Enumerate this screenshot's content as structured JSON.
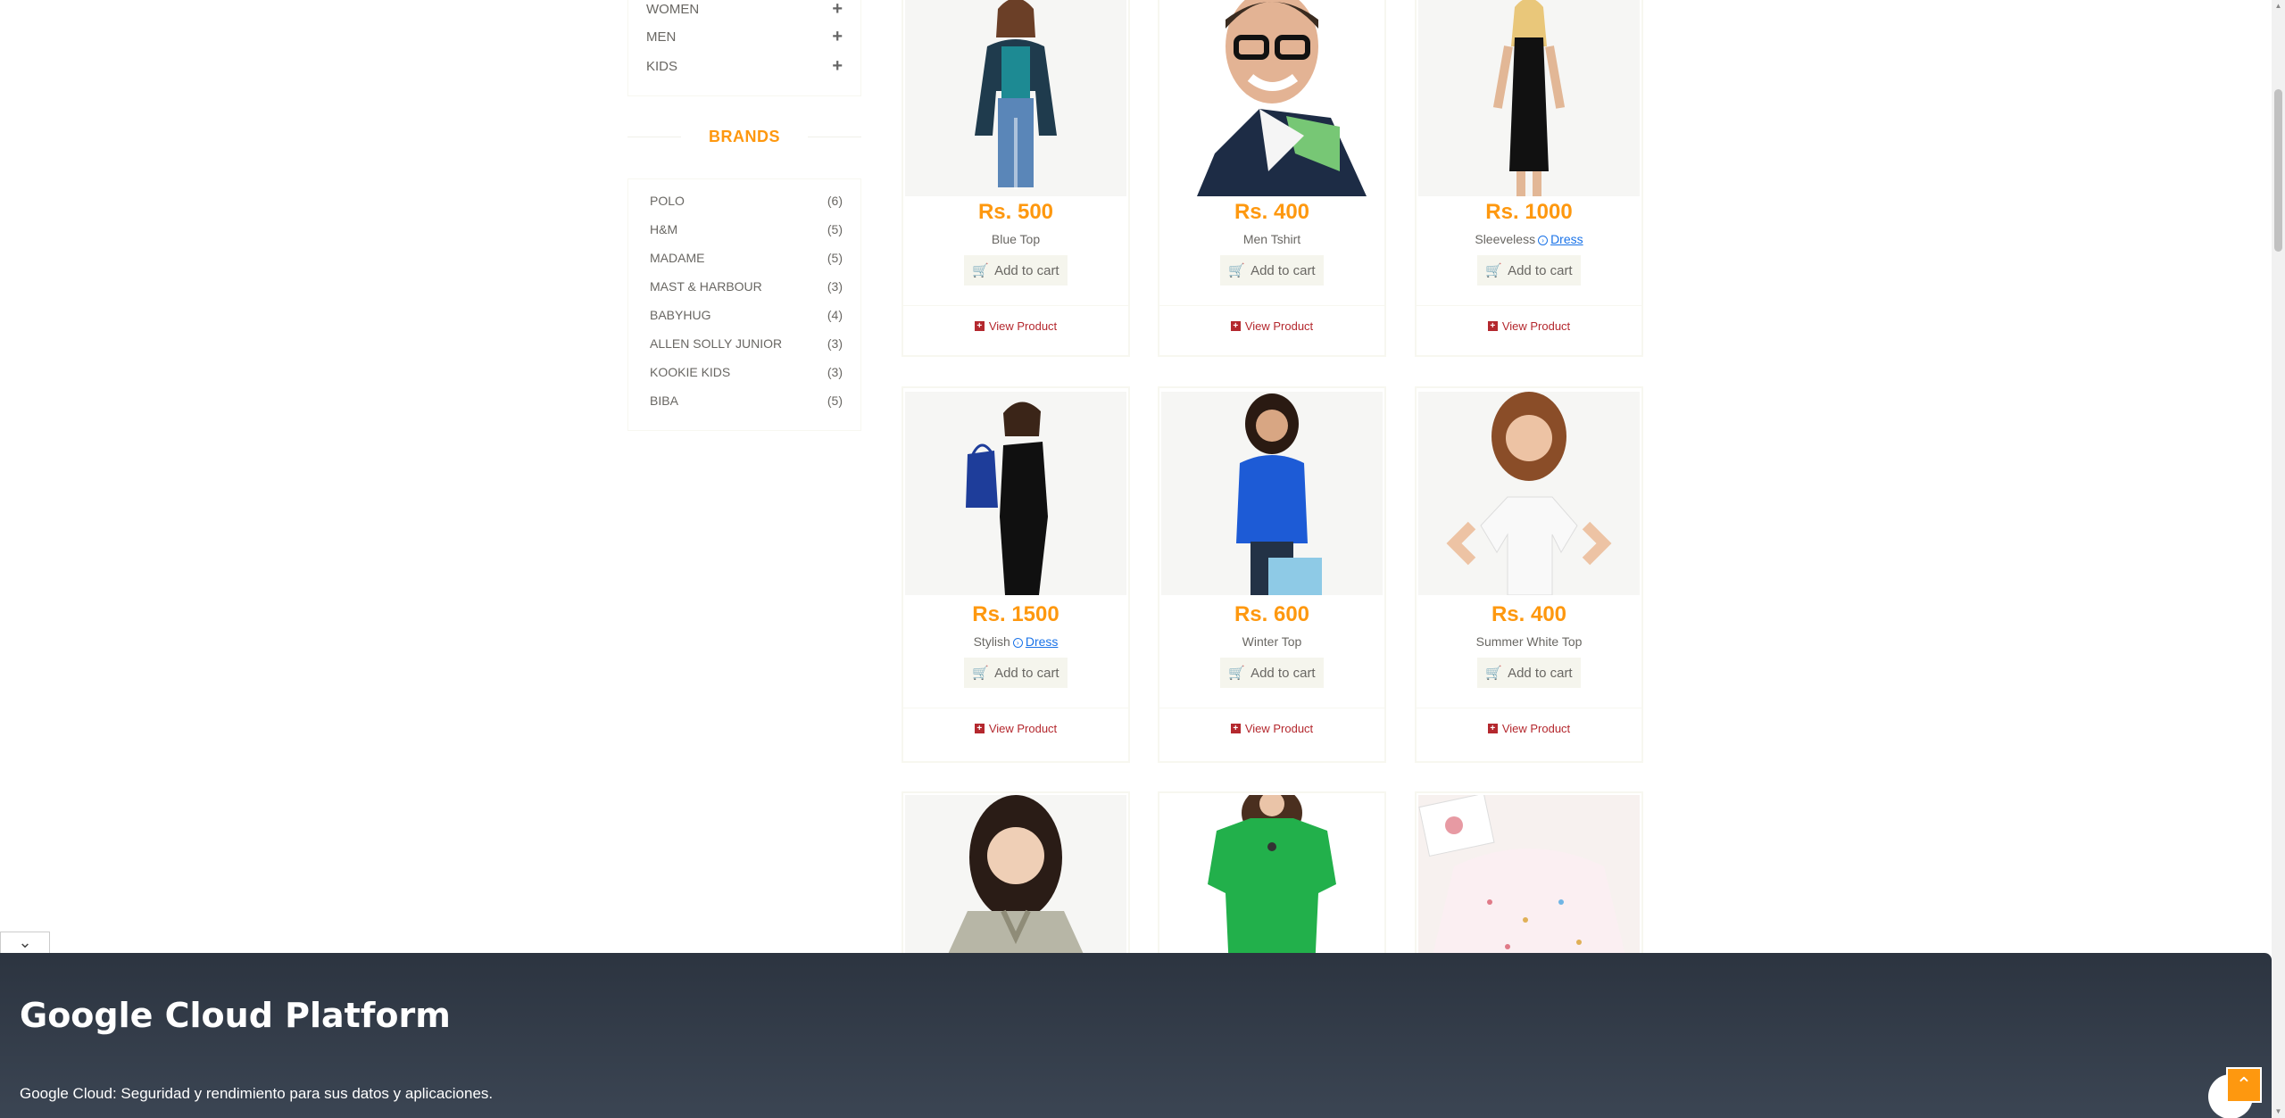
{
  "categories": [
    {
      "label": "WOMEN"
    },
    {
      "label": "MEN"
    },
    {
      "label": "KIDS"
    }
  ],
  "brands": {
    "title": "BRANDS",
    "items": [
      {
        "name": "POLO",
        "count": "(6)"
      },
      {
        "name": "H&M",
        "count": "(5)"
      },
      {
        "name": "MADAME",
        "count": "(5)"
      },
      {
        "name": "MAST & HARBOUR",
        "count": "(3)"
      },
      {
        "name": "BABYHUG",
        "count": "(4)"
      },
      {
        "name": "ALLEN SOLLY JUNIOR",
        "count": "(3)"
      },
      {
        "name": "KOOKIE KIDS",
        "count": "(3)"
      },
      {
        "name": "BIBA",
        "count": "(5)"
      }
    ]
  },
  "products": [
    {
      "price": "Rs. 500",
      "name": "Blue Top",
      "link": "",
      "cart": "Add to cart",
      "view": "View Product"
    },
    {
      "price": "Rs. 400",
      "name": "Men Tshirt",
      "link": "",
      "cart": "Add to cart",
      "view": "View Product"
    },
    {
      "price": "Rs. 1000",
      "name": "Sleeveless",
      "link": "Dress",
      "cart": "Add to cart",
      "view": "View Product"
    },
    {
      "price": "Rs. 1500",
      "name": "Stylish",
      "link": "Dress",
      "cart": "Add to cart",
      "view": "View Product"
    },
    {
      "price": "Rs. 600",
      "name": "Winter Top",
      "link": "",
      "cart": "Add to cart",
      "view": "View Product"
    },
    {
      "price": "Rs. 400",
      "name": "Summer White Top",
      "link": "",
      "cart": "Add to cart",
      "view": "View Product"
    }
  ],
  "ad": {
    "title": "Google Cloud Platform",
    "subtitle": "Google Cloud: Seguridad y rendimiento para sus datos y aplicaciones."
  },
  "colors": {
    "accent": "#fe980f",
    "view_link": "#b4282e",
    "ad_bg": "#2c3440"
  }
}
